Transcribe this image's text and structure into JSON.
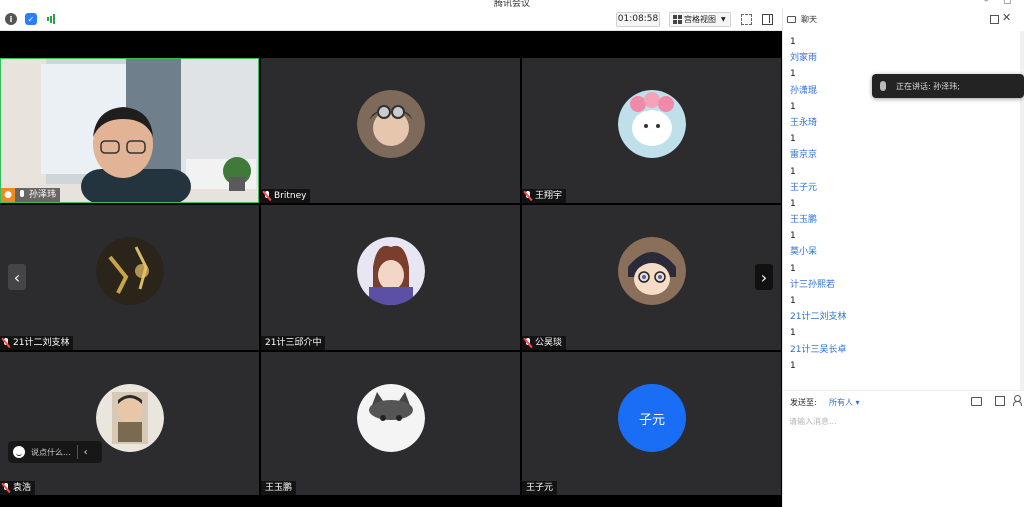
{
  "window": {
    "title": "腾讯会议",
    "controls": [
      "–",
      "▢"
    ]
  },
  "toolbar": {
    "timer": "01:08:58",
    "view_label": "宫格视图"
  },
  "tiles": [
    {
      "name": "孙泽玮",
      "speaking": true
    },
    {
      "name": "Britney",
      "mic_muted": true
    },
    {
      "name": "王翔宇",
      "mic_muted": true
    },
    {
      "name": "21计二刘支林",
      "mic_muted": true
    },
    {
      "name": "21计三邱介中",
      "mic_muted": false
    },
    {
      "name": "公昊琰",
      "mic_muted": true
    },
    {
      "name": "袁浩",
      "mic_muted": true
    },
    {
      "name": "王玉鹏",
      "mic_muted": false
    },
    {
      "name": "王子元",
      "mic_muted": false,
      "avatar_text": "子元",
      "avatar_color": "#1a6ef5"
    }
  ],
  "quick_chat": {
    "placeholder": "说点什么..."
  },
  "chat": {
    "title": "聊天",
    "messages": [
      {
        "text": "1"
      },
      {
        "sender": "刘家雨"
      },
      {
        "text": "1"
      },
      {
        "sender": "孙潇琨"
      },
      {
        "text": "1"
      },
      {
        "sender": "王永琦"
      },
      {
        "text": "1"
      },
      {
        "sender": "雷京京"
      },
      {
        "text": "1"
      },
      {
        "sender": "王子元"
      },
      {
        "text": "1"
      },
      {
        "sender": "王玉鹏"
      },
      {
        "text": "1"
      },
      {
        "sender": "莫小呆"
      },
      {
        "text": "1"
      },
      {
        "sender": "计三孙熙若"
      },
      {
        "text": "1"
      },
      {
        "sender": "21计二刘支林"
      },
      {
        "text": "1"
      },
      {
        "sender": "21计三吴长卓"
      },
      {
        "text": "1"
      }
    ],
    "send_to_label": "发送至:",
    "recipient": "所有人 ▾",
    "input_placeholder": "请输入消息..."
  },
  "speaking_banner": {
    "text": "正在讲话: 孙泽玮;"
  },
  "colors": {
    "accent": "#2f6fd6",
    "speaking_border": "#35c05b",
    "tile_bg": "#2c2c2e"
  }
}
